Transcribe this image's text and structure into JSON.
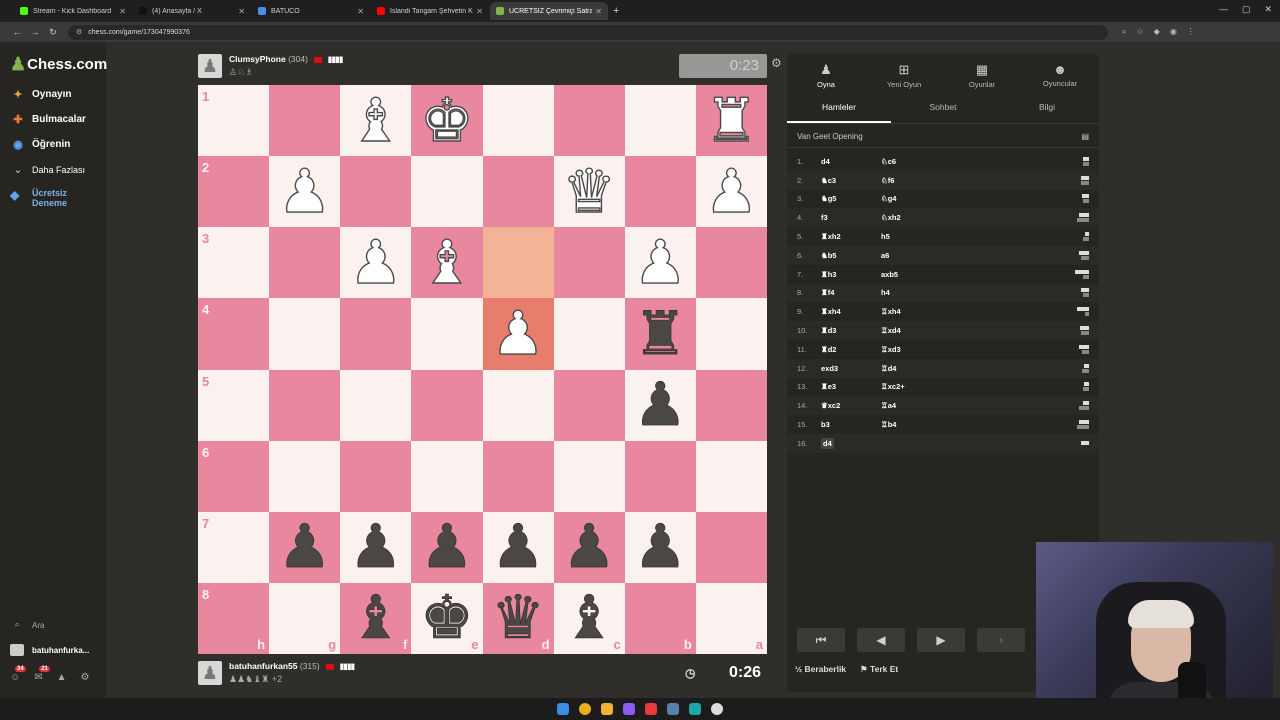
{
  "browser": {
    "tabs": [
      {
        "title": "Stream - Kick Dashboard",
        "color": "#53fc18"
      },
      {
        "title": "(4) Anasayfa / X",
        "color": "#111111"
      },
      {
        "title": "BATUCO",
        "color": "#4a90e2"
      },
      {
        "title": "İslandi Tangam Şehvetin Kremi",
        "color": "#ff0000"
      },
      {
        "title": "ÜCRETSİZ Çevrimiçi Satranç Oy",
        "color": "#81b64c"
      }
    ],
    "url": "chess.com/game/173047990376"
  },
  "sidebar": {
    "logo": "Chess.com",
    "items": [
      {
        "label": "Oynayın",
        "icon": "play-icon"
      },
      {
        "label": "Bulmacalar",
        "icon": "puzzle-icon"
      },
      {
        "label": "Öğrenin",
        "icon": "learn-icon"
      },
      {
        "label": "Daha Fazlası",
        "icon": "more-icon"
      }
    ],
    "trial_line1": "Ücretsiz",
    "trial_line2": "Deneme",
    "search": "Ara",
    "user": "batuhanfurka...",
    "badge_a": "34",
    "badge_b": "21"
  },
  "top_player": {
    "name": "ClumsyPhone",
    "rating": "(304)",
    "clock": "0:23"
  },
  "bottom_player": {
    "name": "batuhanfurkan55",
    "rating": "(315)",
    "captured_extra": "+2",
    "clock": "0:26"
  },
  "board": {
    "ranks": [
      "1",
      "2",
      "3",
      "4",
      "5",
      "6",
      "7",
      "8"
    ],
    "files": [
      "h",
      "g",
      "f",
      "e",
      "d",
      "c",
      "b",
      "a"
    ],
    "pieces": [
      [
        "",
        "",
        "♗",
        "♔",
        "",
        "",
        "",
        "♖"
      ],
      [
        "",
        "♙",
        "",
        "",
        "",
        "♕",
        "",
        "♙"
      ],
      [
        "",
        "",
        "♙",
        "♗",
        "",
        "",
        "♙",
        ""
      ],
      [
        "",
        "",
        "",
        "",
        "♙",
        "",
        "♜",
        ""
      ],
      [
        "",
        "",
        "",
        "",
        "",
        "",
        "♟",
        ""
      ],
      [
        "",
        "",
        "",
        "",
        "",
        "",
        "",
        ""
      ],
      [
        "",
        "♟",
        "♟",
        "♟",
        "♟",
        "♟",
        "♟",
        ""
      ],
      [
        "",
        "",
        "♝",
        "♚",
        "♛",
        "♝",
        "",
        ""
      ]
    ],
    "highlight_from": [
      2,
      4
    ],
    "highlight_to": [
      3,
      4
    ],
    "colors": {
      "light": "#fbf1ef",
      "dark": "#e8879d"
    }
  },
  "panel": {
    "tabs": [
      {
        "label": "Oyna",
        "icon": "pawn-icon"
      },
      {
        "label": "Yeni Oyun",
        "icon": "plus-icon"
      },
      {
        "label": "Oyunlar",
        "icon": "grid-icon"
      },
      {
        "label": "Oyuncular",
        "icon": "people-icon"
      }
    ],
    "subtabs": [
      "Hamleler",
      "Sohbet",
      "Bilgi"
    ],
    "opening": "Van Geet Opening",
    "moves": [
      {
        "n": "1.",
        "w": "d4",
        "b": "♘c6"
      },
      {
        "n": "2.",
        "w": "♞c3",
        "b": "♘f6"
      },
      {
        "n": "3.",
        "w": "♞g5",
        "b": "♘g4"
      },
      {
        "n": "4.",
        "w": "f3",
        "b": "♘xh2"
      },
      {
        "n": "5.",
        "w": "♜xh2",
        "b": "h5"
      },
      {
        "n": "6.",
        "w": "♞b5",
        "b": "a6"
      },
      {
        "n": "7.",
        "w": "♜h3",
        "b": "axb5"
      },
      {
        "n": "8.",
        "w": "♜f4",
        "b": "h4"
      },
      {
        "n": "9.",
        "w": "♜xh4",
        "b": "♖xh4"
      },
      {
        "n": "10.",
        "w": "♜d3",
        "b": "♖xd4"
      },
      {
        "n": "11.",
        "w": "♜d2",
        "b": "♖xd3"
      },
      {
        "n": "12.",
        "w": "exd3",
        "b": "♖d4"
      },
      {
        "n": "13.",
        "w": "♜e3",
        "b": "♖xc2+"
      },
      {
        "n": "14.",
        "w": "♛xc2",
        "b": "♖a4"
      },
      {
        "n": "15.",
        "w": "b3",
        "b": "♖b4"
      },
      {
        "n": "16.",
        "w": "d4",
        "b": ""
      }
    ],
    "draw": "Beraberlik",
    "resign": "Terk Et"
  }
}
